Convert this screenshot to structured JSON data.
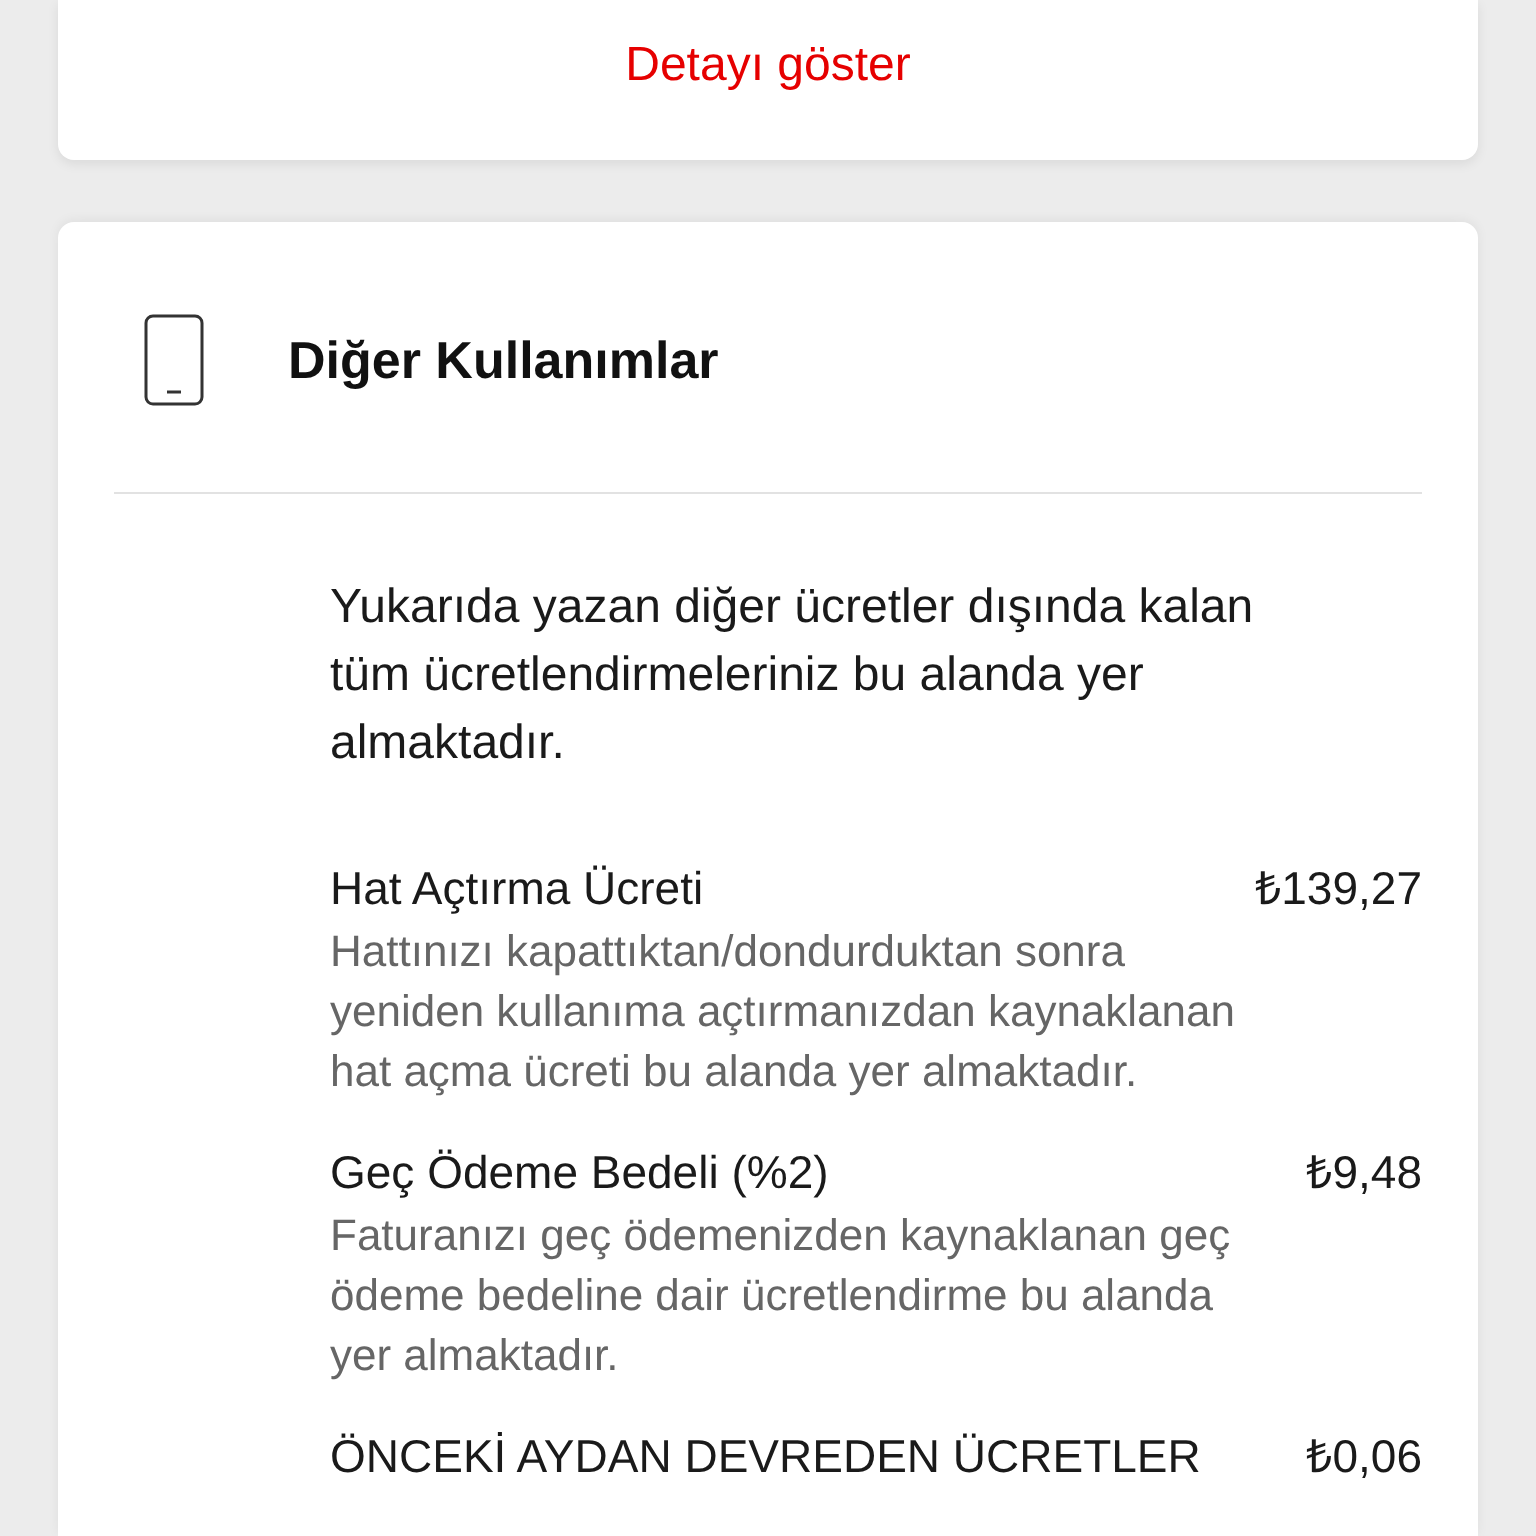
{
  "detail_link": {
    "label": "Detayı göster"
  },
  "section": {
    "title": "Diğer Kullanımlar",
    "description": "Yukarıda yazan diğer ücretler dışında kalan tüm ücretlendirmeleriniz bu alanda yer almaktadır.",
    "items": [
      {
        "name": "Hat Açtırma Ücreti",
        "amount": "₺139,27",
        "description": "Hattınızı kapattıktan/dondurduktan sonra yeniden kullanıma açtırmanızdan kaynaklanan hat açma ücreti bu alanda yer almaktadır."
      },
      {
        "name": "Geç Ödeme Bedeli (%2)",
        "amount": "₺9,48",
        "description": "Faturanızı geç ödemenizden kaynaklanan geç ödeme bedeline dair ücretlendirme bu alanda yer almaktadır."
      },
      {
        "name": "ÖNCEKİ AYDAN DEVREDEN ÜCRETLER",
        "amount": "₺0,06"
      }
    ]
  }
}
